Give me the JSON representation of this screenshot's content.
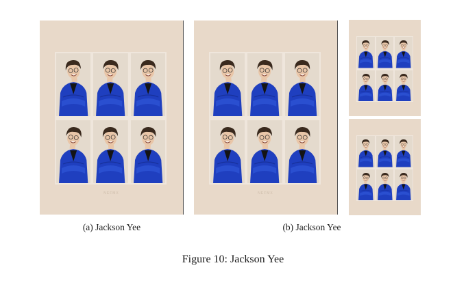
{
  "panels": {
    "a": {
      "photo_count": 6,
      "watermark": "NEFMX"
    },
    "b": {
      "photo_count": 6,
      "watermark": "NEFMX"
    },
    "c1": {
      "photo_count": 6
    },
    "c2": {
      "photo_count": 6
    }
  },
  "subcaptions": {
    "a": "(a) Jackson Yee",
    "b": "(b) Jackson Yee"
  },
  "figure_caption": "Figure 10: Jackson Yee",
  "colors": {
    "background": "#e8d9c9",
    "jacket": "#1f3fbf",
    "hair": "#3a2a1e",
    "skin": "#e9c6a8"
  }
}
